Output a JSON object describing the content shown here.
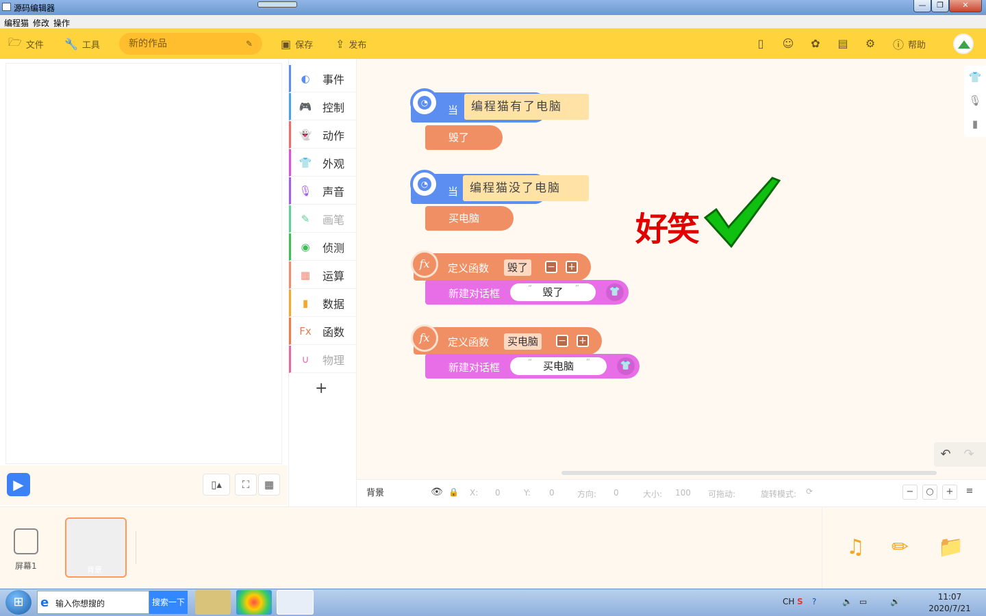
{
  "window": {
    "title": "源码编辑器",
    "minimize": "—",
    "maximize": "❐",
    "close": "✕"
  },
  "menu": [
    "编程猫",
    "修改",
    "操作"
  ],
  "toolbar": {
    "file": "文件",
    "tools": "工具",
    "project_name": "新的作品",
    "save": "保存",
    "publish": "发布",
    "help": "帮助"
  },
  "categories": [
    {
      "label": "事件",
      "color": "#5b8ef0",
      "icon": "toggle-icon",
      "dim": false
    },
    {
      "label": "控制",
      "color": "#4aa3e8",
      "icon": "gamepad-icon",
      "dim": false
    },
    {
      "label": "动作",
      "color": "#ef6a6a",
      "icon": "ghost-icon",
      "dim": false
    },
    {
      "label": "外观",
      "color": "#e04fd9",
      "icon": "shirt-icon",
      "dim": false
    },
    {
      "label": "声音",
      "color": "#a25fe8",
      "icon": "microphone-icon",
      "dim": false
    },
    {
      "label": "画笔",
      "color": "#5fd09a",
      "icon": "pen-icon",
      "dim": true
    },
    {
      "label": "侦测",
      "color": "#3cbf55",
      "icon": "target-icon",
      "dim": false
    },
    {
      "label": "运算",
      "color": "#f08c72",
      "icon": "calculator-icon",
      "dim": false
    },
    {
      "label": "数据",
      "color": "#f4a82c",
      "icon": "bar-chart-icon",
      "dim": false
    },
    {
      "label": "函数",
      "color": "#ef7a4a",
      "icon": "function-icon",
      "dim": false
    },
    {
      "label": "物理",
      "color": "#e46aa6",
      "icon": "magnet-icon",
      "dim": true
    }
  ],
  "add_category": "+",
  "blocks": {
    "when_label": "当",
    "event1": "编程猫有了电脑",
    "stack1": "毁了",
    "event2": "编程猫没了电脑",
    "stack2": "买电脑",
    "define_label": "定义函数",
    "func1_arg": "毁了",
    "dialog_label": "新建对话框",
    "func1_text": "毁了",
    "func2_arg": "买电脑",
    "func2_text": "买电脑",
    "fx": "fx",
    "open_quote": "“",
    "close_quote": "”",
    "minus": "−",
    "plus": "+"
  },
  "overlay": {
    "text": "好笑"
  },
  "status": {
    "sprite": "背景",
    "x_label": "X:",
    "x": "0",
    "y_label": "Y:",
    "y": "0",
    "dir_label": "方向:",
    "dir": "0",
    "size_label": "大小:",
    "size": "100",
    "drag_label": "可拖动:",
    "rotate_label": "旋转模式:"
  },
  "bottom": {
    "screen_label": "屏幕1",
    "bg_label": "背景"
  },
  "taskbar": {
    "search_placeholder": "输入你想搜的",
    "search_button": "搜索一下",
    "lang": "CH",
    "time": "11:07",
    "date": "2020/7/21"
  }
}
